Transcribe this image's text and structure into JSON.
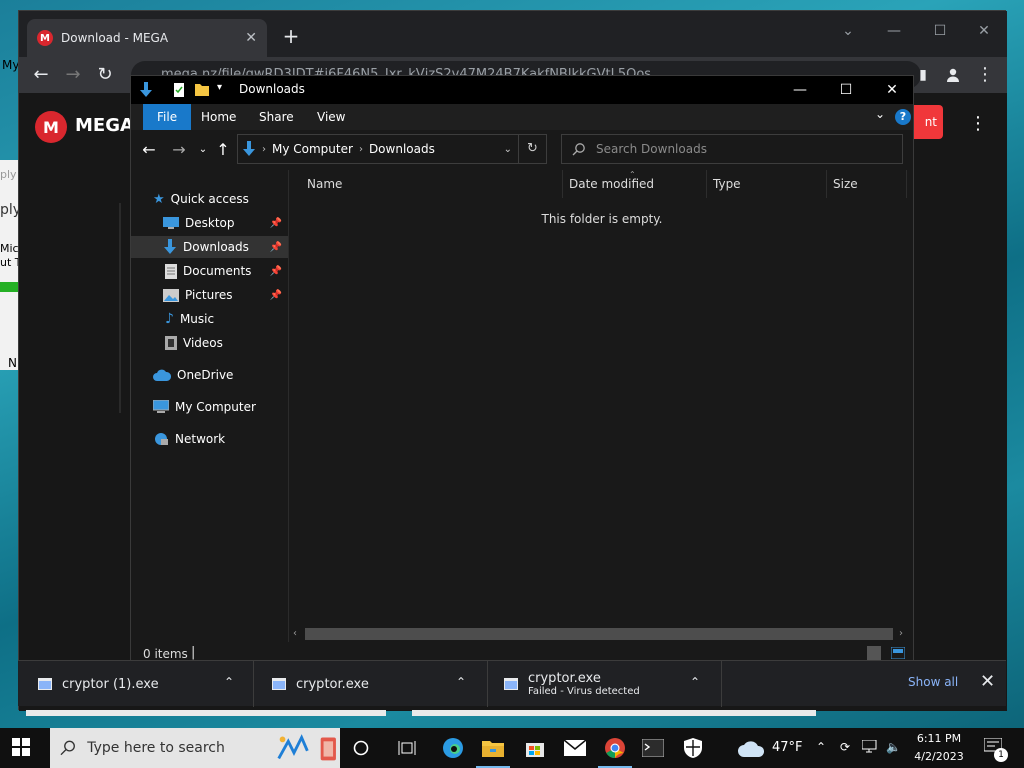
{
  "browser": {
    "tab_title": "Download - MEGA",
    "new_tab": "+",
    "url": "mega.nz/file/gwRD3JDT#i6F46N5_Jxr_kVjzS2v47M24B7KakfNBlkkGVtL5Oos",
    "mega_badge": "M",
    "mega_logo_text": "MEGA",
    "mega_red_button_fragment": "nt"
  },
  "background_text": {
    "my": "My",
    "ply1": "ply",
    "ply2": "ply",
    "micr": "Micr",
    "ut": "ut T",
    "n": "N"
  },
  "explorer": {
    "title": "Downloads",
    "ribbon_tabs": [
      "File",
      "Home",
      "Share",
      "View"
    ],
    "help": "?",
    "breadcrumb": [
      "My Computer",
      "Downloads"
    ],
    "search_placeholder": "Search Downloads",
    "nav": {
      "quick_access": "Quick access",
      "desktop": "Desktop",
      "downloads": "Downloads",
      "documents": "Documents",
      "pictures": "Pictures",
      "music": "Music",
      "videos": "Videos",
      "onedrive": "OneDrive",
      "my_computer": "My Computer",
      "network": "Network"
    },
    "columns": {
      "name": "Name",
      "date_modified": "Date modified",
      "type": "Type",
      "size": "Size"
    },
    "empty_message": "This folder is empty.",
    "status_items": "0 items",
    "status_caret": "|"
  },
  "downloads_bar": {
    "items": [
      {
        "name": "cryptor (1).exe"
      },
      {
        "name": "cryptor.exe"
      },
      {
        "name": "cryptor.exe",
        "status": "Failed - Virus detected"
      }
    ],
    "show_all": "Show all"
  },
  "taskbar": {
    "search_placeholder": "Type here to search",
    "temperature": "47°F",
    "time": "6:11 PM",
    "date": "4/2/2023",
    "notification_count": "1"
  },
  "colors": {
    "accent_blue": "#1979ca",
    "mega_red": "#d9272e",
    "link_blue": "#8ab4f8"
  }
}
